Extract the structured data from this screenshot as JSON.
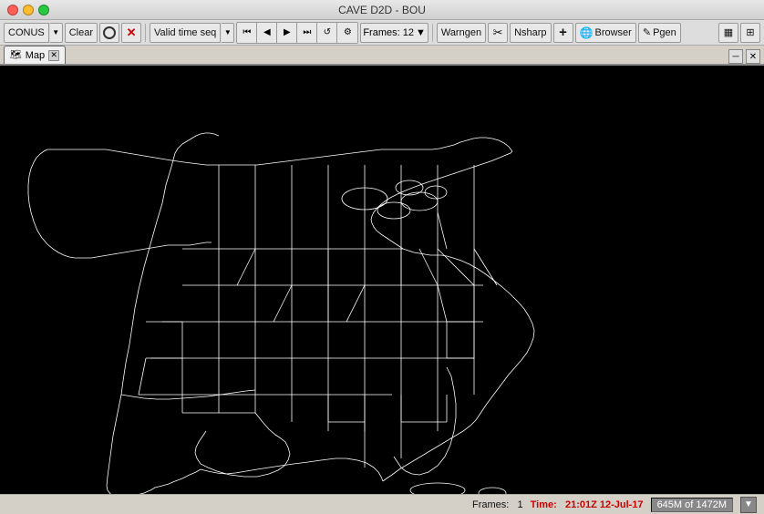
{
  "window": {
    "title": "CAVE D2D - BOU",
    "controls": {
      "close": "●",
      "minimize": "●",
      "maximize": "●"
    }
  },
  "toolbar": {
    "conus_label": "CONUS",
    "clear_label": "Clear",
    "valid_time_seq_label": "Valid time seq",
    "frames_label": "Frames: 12",
    "frames_dropdown_arrow": "▼",
    "warngen_label": "Warngen",
    "nsharp_label": "Nsharp",
    "browser_label": "Browser",
    "pgen_label": "Pgen",
    "nav_first": "⏮",
    "nav_prev": "◀",
    "nav_next": "▶",
    "nav_last": "⏭",
    "nav_reload": "↺",
    "nav_settings": "⚙",
    "plus_icon": "+",
    "icon_grid": "▦",
    "icon_cross": "✕"
  },
  "tabs": [
    {
      "label": "Map",
      "active": true,
      "closable": true
    }
  ],
  "tab_controls": {
    "restore": "🗗",
    "close": "✕"
  },
  "map": {
    "background": "#000000",
    "outline_color": "#ffffff"
  },
  "status_bar": {
    "frames_label": "Frames:",
    "frames_value": "1",
    "time_label": "Time:",
    "time_value": "21:01Z 12-Jul-17",
    "memory_value": "645M of 1472M"
  }
}
